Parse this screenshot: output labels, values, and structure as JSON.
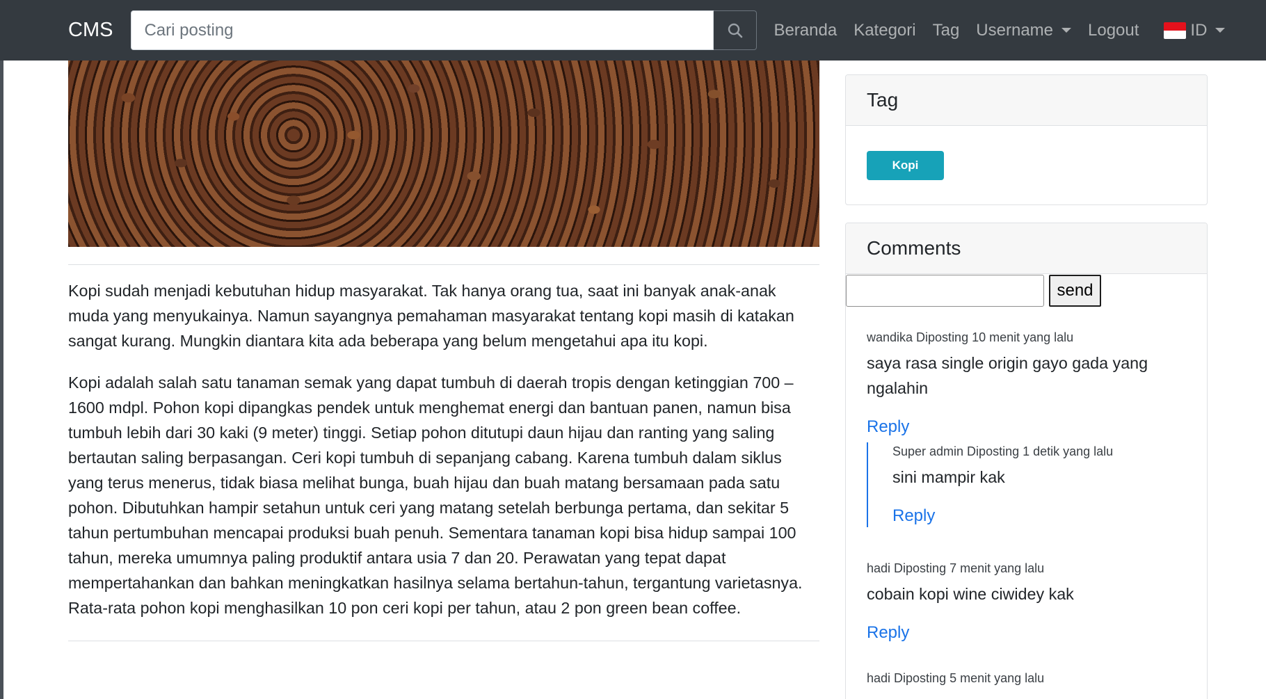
{
  "navbar": {
    "brand": "CMS",
    "search_placeholder": "Cari posting",
    "links": {
      "home": "Beranda",
      "category": "Kategori",
      "tag": "Tag",
      "user": "Username",
      "logout": "Logout",
      "language": "ID"
    }
  },
  "article": {
    "paragraphs": [
      "Kopi sudah menjadi kebutuhan hidup masyarakat. Tak hanya orang tua, saat ini banyak anak-anak muda yang menyukainya. Namun sayangnya pemahaman masyarakat tentang kopi masih di katakan sangat kurang. Mungkin diantara kita ada beberapa yang belum mengetahui apa itu kopi.",
      "Kopi adalah salah satu tanaman semak yang dapat tumbuh di daerah tropis dengan ketinggian 700 – 1600 mdpl. Pohon kopi dipangkas pendek untuk menghemat energi dan bantuan panen, namun bisa tumbuh lebih dari 30 kaki (9 meter) tinggi. Setiap pohon ditutupi daun hijau dan ranting yang saling bertautan saling berpasangan. Ceri kopi tumbuh di sepanjang cabang. Karena tumbuh dalam siklus yang terus menerus, tidak biasa melihat bunga, buah hijau dan buah matang bersamaan pada satu pohon. Dibutuhkan hampir setahun untuk ceri yang matang setelah berbunga pertama, dan sekitar 5 tahun pertumbuhan mencapai produksi buah penuh. Sementara tanaman kopi bisa hidup sampai 100 tahun, mereka umumnya paling produktif antara usia 7 dan 20. Perawatan yang tepat dapat mempertahankan dan bahkan meningkatkan hasilnya selama bertahun-tahun, tergantung varietasnya. Rata-rata pohon kopi menghasilkan 10 pon ceri kopi per tahun, atau 2 pon green bean coffee."
    ]
  },
  "sidebar": {
    "tag_card": {
      "title": "Tag",
      "tags": [
        "Kopi"
      ]
    },
    "comments_card": {
      "title": "Comments",
      "input_value": "",
      "send_label": "send",
      "comments": [
        {
          "meta": "wandika Diposting 10 menit yang lalu",
          "body": "saya rasa single origin gayo gada yang ngalahin",
          "reply_label": "Reply",
          "replies": [
            {
              "meta": "Super admin Diposting 1 detik yang lalu",
              "body": "sini mampir kak",
              "reply_label": "Reply"
            }
          ]
        },
        {
          "meta": "hadi Diposting 7 menit yang lalu",
          "body": "cobain kopi wine ciwidey kak",
          "reply_label": "Reply"
        },
        {
          "meta": "hadi Diposting 5 menit yang lalu"
        }
      ]
    }
  },
  "colors": {
    "navbar_bg": "#343a40",
    "tag_badge": "#17a2b8",
    "link": "#1a73e8"
  },
  "icons": [
    "search-icon",
    "indonesia-flag-icon",
    "caret-down-icon"
  ]
}
